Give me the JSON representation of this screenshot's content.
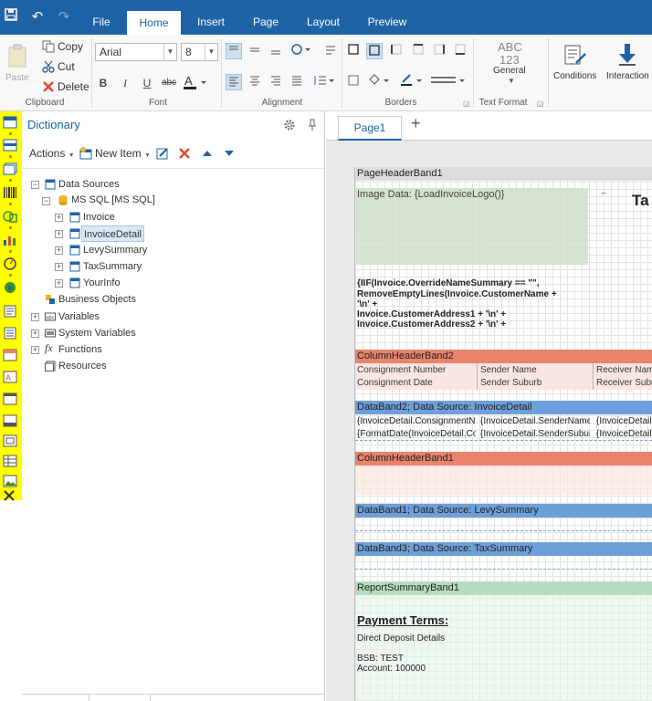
{
  "tabs": [
    "File",
    "Home",
    "Insert",
    "Page",
    "Layout",
    "Preview"
  ],
  "active_tab": "Home",
  "ribbon": {
    "clipboard": {
      "paste": "Paste",
      "copy": "Copy",
      "cut": "Cut",
      "delete": "Delete",
      "label": "Clipboard"
    },
    "font": {
      "family": "Arial",
      "size": "8",
      "label": "Font",
      "bold": "B",
      "italic": "I",
      "underline": "U",
      "strike": "abc"
    },
    "alignment": {
      "label": "Alignment"
    },
    "borders": {
      "label": "Borders"
    },
    "text_format": {
      "sample_top": "ABC",
      "sample_bottom": "123",
      "format": "General",
      "label": "Text Format"
    },
    "conditions": "Conditions",
    "interaction": "Interaction"
  },
  "dictionary": {
    "title": "Dictionary",
    "actions": "Actions",
    "new_item": "New Item",
    "tree": {
      "data_sources": "Data Sources",
      "connection": "MS SQL [MS SQL]",
      "tables": [
        "Invoice",
        "InvoiceDetail",
        "LevySummary",
        "TaxSummary",
        "YourInfo"
      ],
      "business_objects": "Business Objects",
      "variables": "Variables",
      "system_variables": "System Variables",
      "functions": "Functions",
      "resources": "Resources"
    }
  },
  "designer": {
    "page_tab": "Page1",
    "add_page": "+",
    "bands": {
      "page_header": "PageHeaderBand1",
      "image_data": "Image Data: {LoadInvoiceLogo()}",
      "title_fragment": "Ta",
      "expr_lines": [
        "{IIF(Invoice.OverrideNameSummary == \"\",",
        "RemoveEmptyLines(Invoice.CustomerName +",
        "'\\n' +",
        "Invoice.CustomerAddress1 + '\\n' +",
        "Invoice.CustomerAddress2 + '\\n' +"
      ],
      "column_header_2": "ColumnHeaderBand2",
      "ch_cells": [
        "Consignment Number",
        "Consignment Date",
        "Sender Name",
        "Sender Suburb",
        "Receiver Nam",
        "Receiver Subu"
      ],
      "data_band_2": "DataBand2; Data Source: InvoiceDetail",
      "db_cells": [
        "{InvoiceDetail.ConsignmentNu",
        "{FormatDate(InvoiceDetail.Con",
        "{InvoiceDetail.SenderName}",
        "{InvoiceDetail.SenderSuburb",
        "{InvoiceDetail.",
        "{InvoiceDetail."
      ],
      "column_header_1": "ColumnHeaderBand1",
      "data_band_1": "DataBand1; Data Source: LevySummary",
      "data_band_3": "DataBand3; Data Source: TaxSummary",
      "report_summary": "ReportSummaryBand1",
      "payment_terms": "Payment Terms:",
      "direct_deposit": "Direct Deposit Details",
      "bsb": "BSB: TEST",
      "account": "Account: 100000"
    }
  },
  "colors": {
    "accent": "#1e63a6",
    "toolbox": "#ffff00",
    "header_band": "#dcdcdc",
    "column_band": "#e8836c",
    "data_band": "#6f9fd8",
    "summary_band": "#b5dcc0"
  }
}
